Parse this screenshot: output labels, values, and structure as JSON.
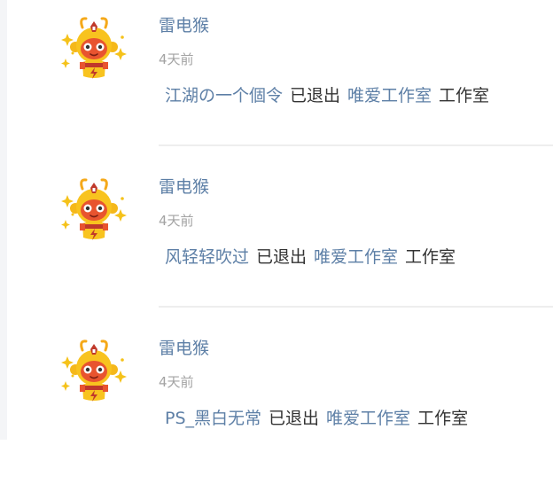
{
  "feed": {
    "items": [
      {
        "user": "雷电猴",
        "time": "4天前",
        "member": "江湖の一个個令",
        "action": "已退出",
        "group": "唯爱工作室",
        "group_suffix": "工作室"
      },
      {
        "user": "雷电猴",
        "time": "4天前",
        "member": "风轻轻吹过",
        "action": "已退出",
        "group": "唯爱工作室",
        "group_suffix": "工作室"
      },
      {
        "user": "雷电猴",
        "time": "4天前",
        "member": "PS_黑白无常",
        "action": "已退出",
        "group": "唯爱工作室",
        "group_suffix": "工作室"
      }
    ]
  },
  "avatar_icon": "monkey-mascot-icon",
  "colors": {
    "link": "#5d7fa6",
    "text": "#333333",
    "muted": "#a3a3a3",
    "divider": "#eeeeee"
  }
}
